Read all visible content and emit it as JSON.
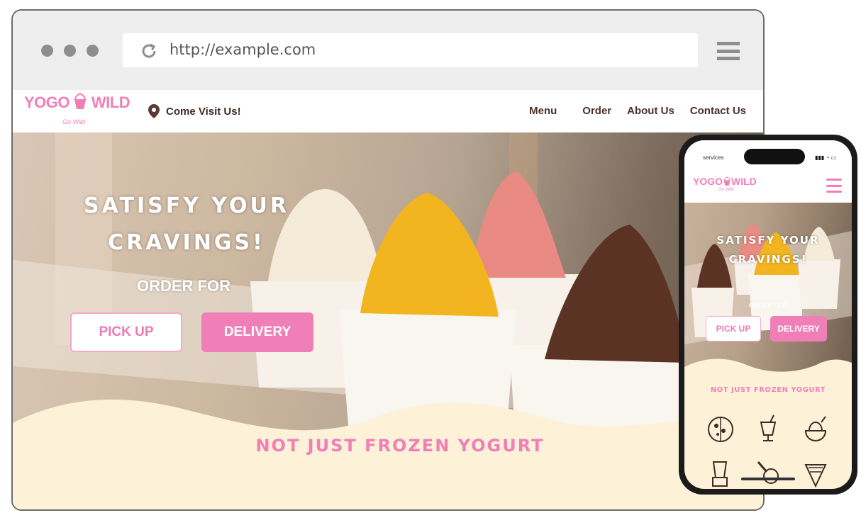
{
  "browser": {
    "url": "http://example.com",
    "icons": [
      "reload-icon",
      "hamburger-menu-icon"
    ]
  },
  "site": {
    "logo": {
      "text_left": "YOGO",
      "text_right": "WILD",
      "tagline": "Go Wild"
    },
    "location": {
      "label": "Come Visit Us!",
      "icon": "location-pin-icon"
    },
    "nav": [
      "Menu",
      "Order",
      "About Us",
      "Contact Us"
    ],
    "hero": {
      "title_line1": "SATISFY YOUR",
      "title_line2": "CRAVINGS!",
      "order_for": "ORDER FOR",
      "pick_up": "PICK UP",
      "delivery": "DELIVERY"
    },
    "section_title": "NOT JUST FROZEN YOGURT"
  },
  "phone": {
    "status_label": "services",
    "logo_left": "YOGO",
    "logo_right": "WILD",
    "tagline": "Go Wild",
    "title_line1": "SATISFY YOUR",
    "title_line2": "CRAVINGS!",
    "order_for": "ORDER FOR",
    "pick_up": "PICK UP",
    "delivery": "DELIVERY",
    "section_title": "NOT JUST FROZEN YOGURT",
    "icons": [
      "pizza-icon",
      "milkshake-icon",
      "yogurt-bowl-icon",
      "blender-icon",
      "ice-cream-scoop-icon",
      "crepe-icon"
    ]
  },
  "colors": {
    "brand_pink": "#f07fb7",
    "cream": "#fdf1d8",
    "brown": "#4a3029"
  }
}
